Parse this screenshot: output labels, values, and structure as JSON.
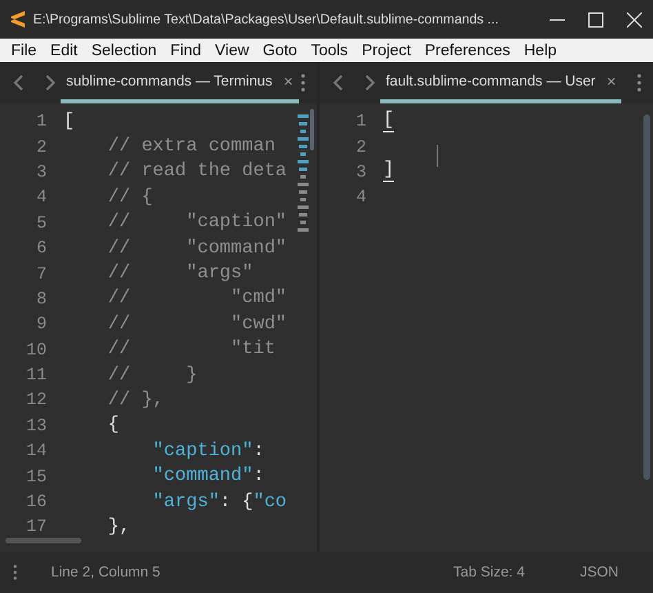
{
  "window": {
    "title": "E:\\Programs\\Sublime Text\\Data\\Packages\\User\\Default.sublime-commands ..."
  },
  "menu": [
    "File",
    "Edit",
    "Selection",
    "Find",
    "View",
    "Goto",
    "Tools",
    "Project",
    "Preferences",
    "Help"
  ],
  "panes": [
    {
      "tabs": [
        {
          "label": "sublime-commands — Terminus",
          "selected": true,
          "close": "×"
        }
      ],
      "lines": [
        {
          "number": "1",
          "tokens": [
            {
              "kind": "punct",
              "text": "["
            }
          ]
        },
        {
          "number": "2",
          "tokens": [
            {
              "kind": "comment",
              "text": "    // extra comman"
            }
          ]
        },
        {
          "number": "3",
          "tokens": [
            {
              "kind": "comment",
              "text": "    // read the deta"
            }
          ]
        },
        {
          "number": "4",
          "tokens": [
            {
              "kind": "comment",
              "text": "    // {"
            }
          ]
        },
        {
          "number": "5",
          "tokens": [
            {
              "kind": "comment",
              "text": "    //     \"caption\""
            }
          ]
        },
        {
          "number": "6",
          "tokens": [
            {
              "kind": "comment",
              "text": "    //     \"command\""
            }
          ]
        },
        {
          "number": "7",
          "tokens": [
            {
              "kind": "comment",
              "text": "    //     \"args\""
            }
          ]
        },
        {
          "number": "8",
          "tokens": [
            {
              "kind": "comment",
              "text": "    //         \"cmd\""
            }
          ]
        },
        {
          "number": "9",
          "tokens": [
            {
              "kind": "comment",
              "text": "    //         \"cwd\""
            }
          ]
        },
        {
          "number": "10",
          "tokens": [
            {
              "kind": "comment",
              "text": "    //         \"tit"
            }
          ]
        },
        {
          "number": "11",
          "tokens": [
            {
              "kind": "comment",
              "text": "    //     }"
            }
          ]
        },
        {
          "number": "12",
          "tokens": [
            {
              "kind": "comment",
              "text": "    // },"
            }
          ]
        },
        {
          "number": "13",
          "tokens": [
            {
              "kind": "punct",
              "text": "    {"
            }
          ]
        },
        {
          "number": "14",
          "tokens": [
            {
              "kind": "key",
              "text": "        \"caption\""
            },
            {
              "kind": "punct",
              "text": ":"
            }
          ]
        },
        {
          "number": "15",
          "tokens": [
            {
              "kind": "key",
              "text": "        \"command\""
            },
            {
              "kind": "punct",
              "text": ":"
            }
          ]
        },
        {
          "number": "16",
          "tokens": [
            {
              "kind": "key",
              "text": "        \"args\""
            },
            {
              "kind": "punct",
              "text": ": {"
            },
            {
              "kind": "key",
              "text": "\"co"
            }
          ]
        },
        {
          "number": "17",
          "tokens": [
            {
              "kind": "punct",
              "text": "    },"
            }
          ]
        }
      ],
      "minimap": true
    },
    {
      "tabs": [
        {
          "label": "fault.sublime-commands — User",
          "selected": true,
          "close": "×"
        }
      ],
      "lines": [
        {
          "number": "1",
          "tokens": [
            {
              "kind": "bracket",
              "text": "["
            }
          ]
        },
        {
          "number": "2"
        },
        {
          "number": "3",
          "tokens": [
            {
              "kind": "bracket",
              "text": "]"
            }
          ]
        },
        {
          "number": "4"
        }
      ],
      "minimap": false
    }
  ],
  "status_bar": {
    "position": "Line 2, Column 5",
    "tab_size": "Tab Size: 4",
    "syntax": "JSON"
  }
}
